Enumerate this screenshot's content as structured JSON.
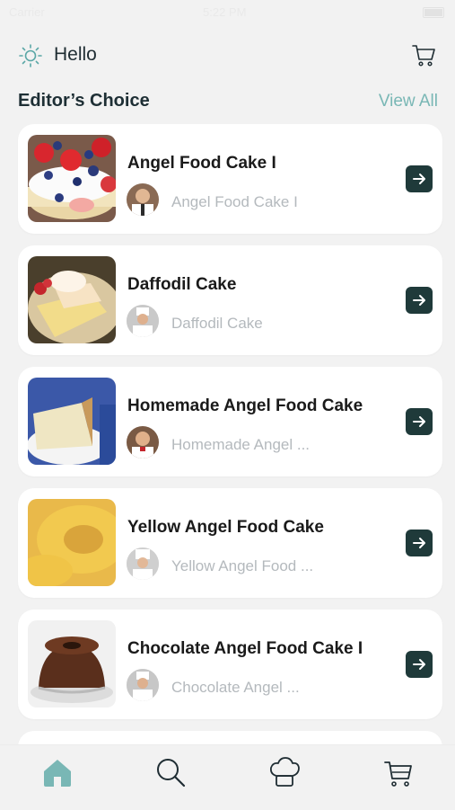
{
  "status_bar": {
    "carrier": "Carrier",
    "time": "5:22 PM"
  },
  "header": {
    "greeting": "Hello"
  },
  "section": {
    "title": "Editor’s Choice",
    "view_all": "View All"
  },
  "recipes": [
    {
      "title": "Angel Food Cake I",
      "subtitle": "Angel Food Cake I",
      "thumb": "strawberry-cake"
    },
    {
      "title": "Daffodil Cake",
      "subtitle": "Daffodil Cake",
      "thumb": "daffodil-cake"
    },
    {
      "title": "Homemade Angel Food Cake",
      "subtitle": "Homemade Angel ...",
      "thumb": "angel-slice"
    },
    {
      "title": "Yellow Angel Food Cake",
      "subtitle": "Yellow Angel Food ...",
      "thumb": "yellow-cake"
    },
    {
      "title": "Chocolate Angel Food Cake I",
      "subtitle": "Chocolate Angel ...",
      "thumb": "chocolate-cake"
    }
  ],
  "tabs": [
    {
      "icon": "home-icon",
      "active": true
    },
    {
      "icon": "search-icon",
      "active": false
    },
    {
      "icon": "chef-hat-icon",
      "active": false
    },
    {
      "icon": "cart-icon",
      "active": false
    }
  ],
  "colors": {
    "accent": "#79b7b5",
    "button": "#1f3a3a",
    "background": "#f2f2f2"
  }
}
